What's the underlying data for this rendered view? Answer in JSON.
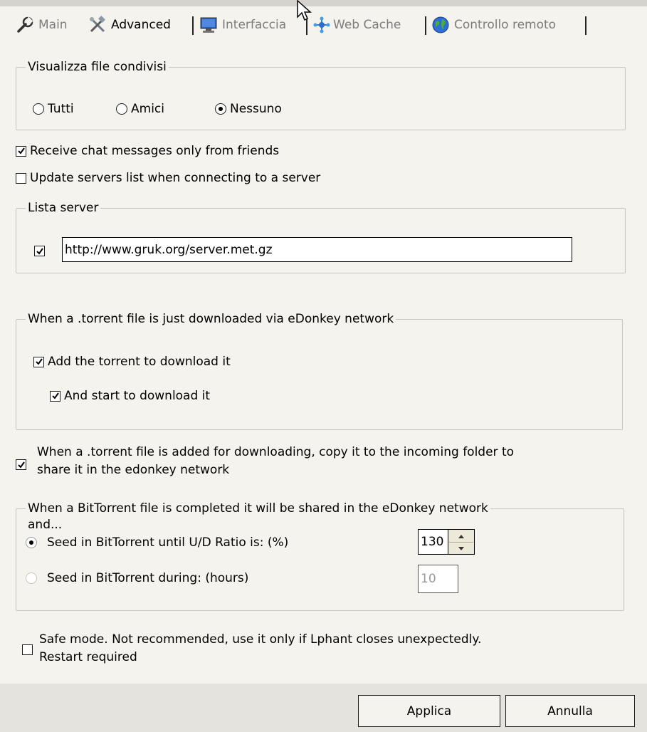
{
  "tabs": [
    {
      "label": "Main",
      "icon": "wrench-icon",
      "active": false
    },
    {
      "label": "Advanced",
      "icon": "tools-icon",
      "active": true
    },
    {
      "label": "Interfaccia",
      "icon": "monitor-icon",
      "active": false
    },
    {
      "label": "Web Cache",
      "icon": "network-icon",
      "active": false
    },
    {
      "label": "Controllo remoto",
      "icon": "globe-icon",
      "active": false
    }
  ],
  "shared_files": {
    "legend": "Visualizza file condivisi",
    "options": [
      "Tutti",
      "Amici",
      "Nessuno"
    ],
    "selected": "Nessuno"
  },
  "chat_friends": {
    "label": "Receive chat messages only from friends",
    "checked": true
  },
  "update_servers": {
    "label": "Update servers list when connecting to a server",
    "checked": false
  },
  "server_list": {
    "legend": "Lista server",
    "checked": true,
    "url": "http://www.gruk.org/server.met.gz"
  },
  "torrent_download": {
    "legend": "When a .torrent file is just downloaded via eDonkey network",
    "add_label": "Add the torrent to download it",
    "add_checked": true,
    "start_label": "And start to download it",
    "start_checked": true
  },
  "copy_torrent": {
    "line1": "When a .torrent file is added for downloading, copy it to the incoming folder to",
    "line2": "share it in the edonkey network",
    "checked": true
  },
  "bittorrent": {
    "legend": "When a BitTorrent file is completed it will be shared in the eDonkey network",
    "legend2": "and...",
    "ratio_label": "Seed in BitTorrent until U/D Ratio is: (%)",
    "ratio_value": "130",
    "hours_label": "Seed in BitTorrent during: (hours)",
    "hours_value": "10",
    "selected": "ratio"
  },
  "safe_mode": {
    "line1": "Safe mode. Not recommended, use it only if Lphant closes unexpectedly.",
    "line2": "Restart required",
    "checked": false
  },
  "buttons": {
    "apply": "Applica",
    "cancel": "Annulla"
  }
}
